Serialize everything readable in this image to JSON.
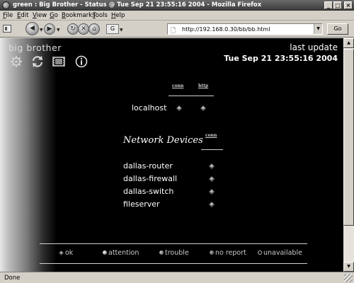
{
  "window": {
    "title": "green : Big Brother - Status @ Tue Sep 21 23:55:16 2004 - Mozilla Firefox",
    "min_glyph": "_",
    "max_glyph": "□",
    "close_glyph": "×"
  },
  "menu": [
    "File",
    "Edit",
    "View",
    "Go",
    "Bookmarks",
    "Tools",
    "Help"
  ],
  "toolbar": {
    "url": "http://192.168.0.30/bb/bb.html",
    "go_label": "Go",
    "back_glyph": "◀",
    "forward_glyph": "▶",
    "reload_glyph": "↻",
    "stop_glyph": "✕",
    "home_glyph": "⌂",
    "g_glyph": "G"
  },
  "page": {
    "brand": "big brother",
    "last_update_label": "last update",
    "last_update_time": "Tue Sep 21 23:55:16 2004",
    "top_group": {
      "columns": [
        "conn",
        "http"
      ],
      "hosts": [
        {
          "name": "localhost",
          "conn": "green",
          "http": "green"
        }
      ]
    },
    "network_group": {
      "title": "Network Devices",
      "columns": [
        "conn"
      ],
      "hosts": [
        {
          "name": "dallas-router",
          "conn": "green"
        },
        {
          "name": "dallas-firewall",
          "conn": "green"
        },
        {
          "name": "dallas-switch",
          "conn": "green"
        },
        {
          "name": "fileserver",
          "conn": "green"
        }
      ]
    },
    "legend": [
      {
        "label": "ok",
        "icon": "diamond"
      },
      {
        "label": "attention",
        "icon": "dot"
      },
      {
        "label": "trouble",
        "icon": "dot"
      },
      {
        "label": "no report",
        "icon": "dot"
      },
      {
        "label": "unavailable",
        "icon": "ring"
      }
    ],
    "tool_icons": [
      "gear-icon",
      "refresh-icon",
      "film-icon",
      "info-icon"
    ]
  },
  "status": {
    "text": "Done"
  },
  "colors": {
    "page_background": "#000000",
    "chrome": "#d4d0c8",
    "status_ok": "#bdbdbd"
  }
}
